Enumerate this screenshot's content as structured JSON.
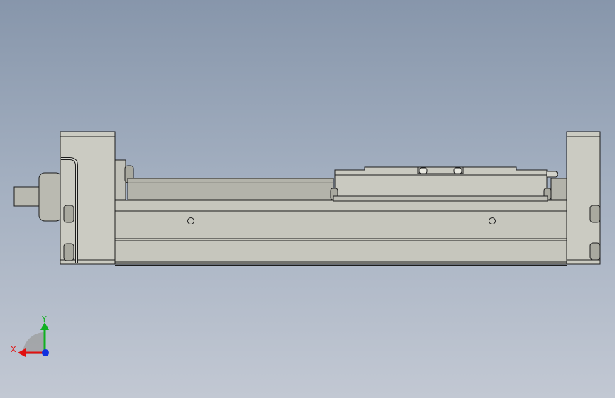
{
  "viewport": {
    "background_top": "#8796ab",
    "background_bottom": "#c2c8d3"
  },
  "model": {
    "body_fill": "#c8c8bf",
    "dark_fill": "#a9a99f",
    "edge_color": "#1c1c1c"
  },
  "triad": {
    "x_label": "X",
    "y_label": "Y",
    "x_color": "#e01010",
    "y_color": "#10b020",
    "z_color": "#1030e0"
  }
}
